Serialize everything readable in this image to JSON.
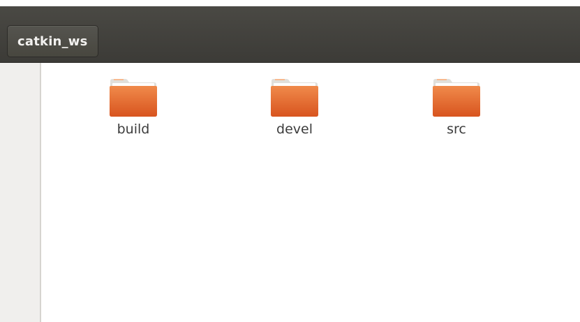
{
  "breadcrumb": {
    "current": "catkin_ws"
  },
  "files": [
    {
      "name": "build",
      "icon": "folder-icon"
    },
    {
      "name": "devel",
      "icon": "folder-icon"
    },
    {
      "name": "src",
      "icon": "folder-icon"
    }
  ],
  "colors": {
    "folder_main": "#e8622a",
    "folder_light": "#f7b990",
    "toolbar": "#3c3b37"
  }
}
